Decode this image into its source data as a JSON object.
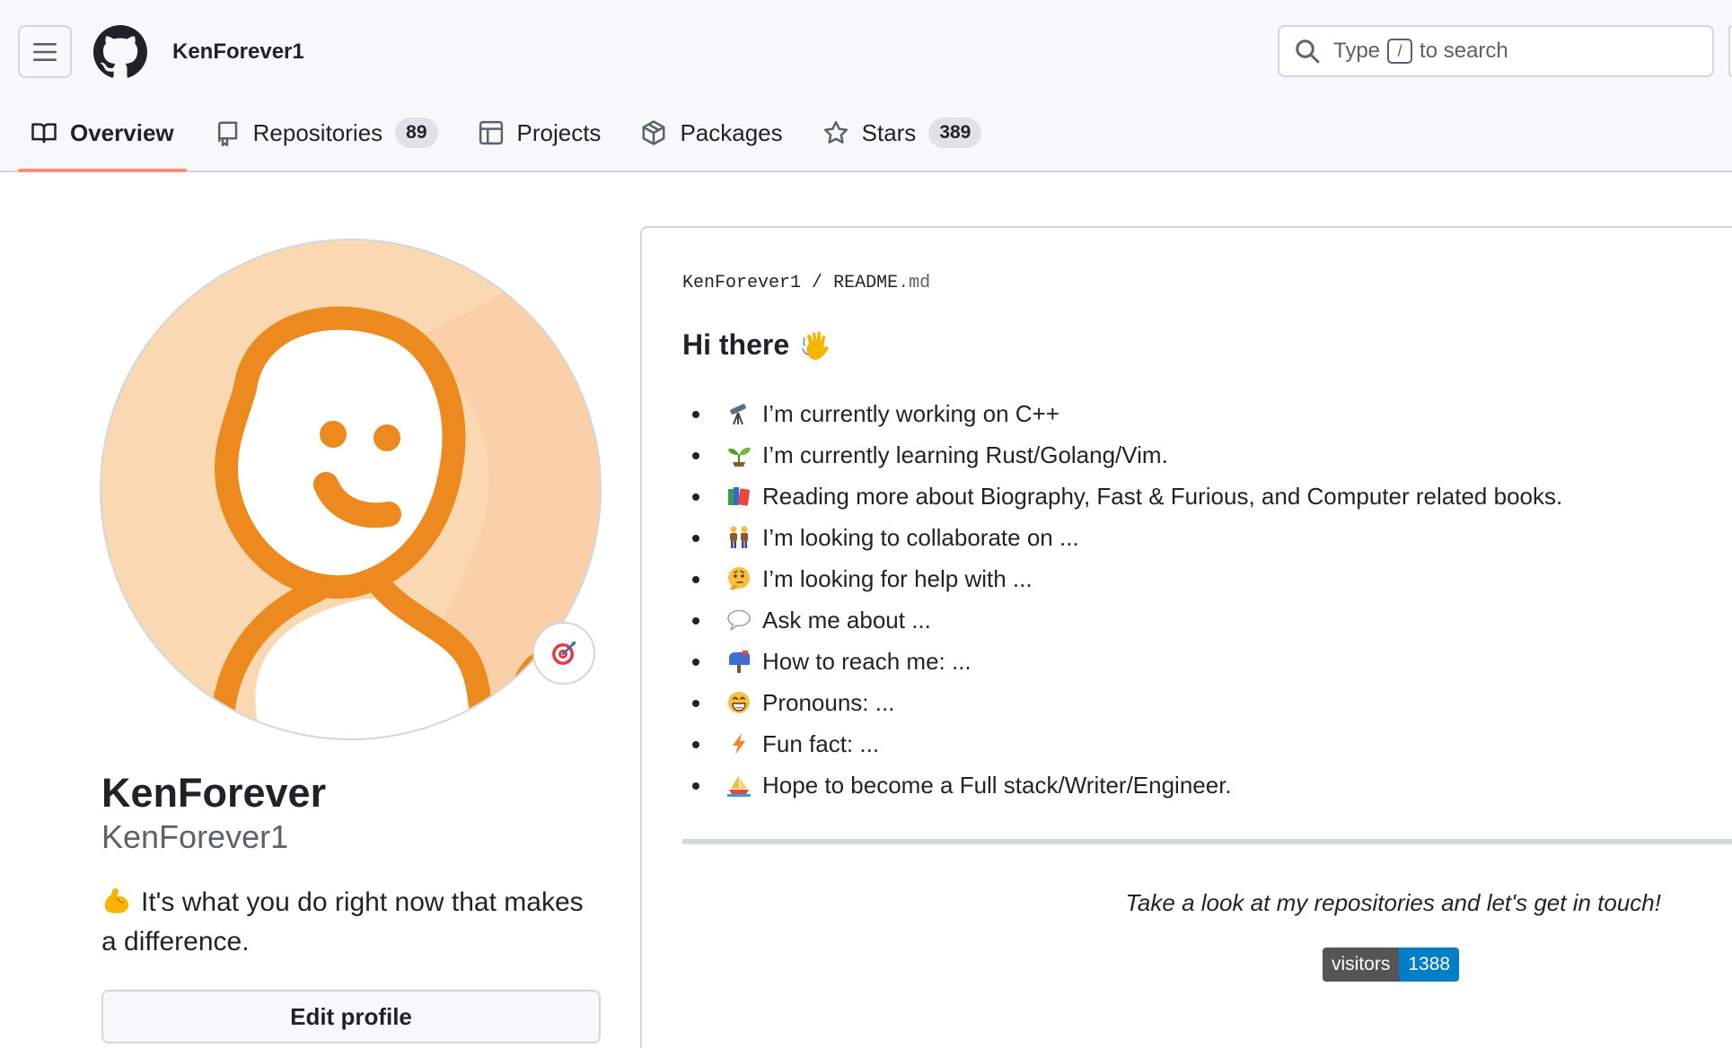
{
  "header": {
    "username": "KenForever1",
    "search": {
      "prefix": "Type",
      "key": "/",
      "suffix": "to search"
    }
  },
  "tabs": [
    {
      "label": "Overview",
      "icon": "book-icon",
      "active": true
    },
    {
      "label": "Repositories",
      "icon": "repo-icon",
      "count": "89"
    },
    {
      "label": "Projects",
      "icon": "table-icon"
    },
    {
      "label": "Packages",
      "icon": "package-icon"
    },
    {
      "label": "Stars",
      "icon": "star-icon",
      "count": "389"
    }
  ],
  "profile": {
    "fullname": "KenForever",
    "login": "KenForever1",
    "bio_emoji": "flexed-biceps",
    "bio": "It's what you do right now that makes a difference.",
    "edit_label": "Edit profile",
    "status_emoji": "dart"
  },
  "readme": {
    "crumb_user": "KenForever1",
    "crumb_sep": "/",
    "crumb_file": "README",
    "crumb_ext": ".md",
    "heading": "Hi there",
    "heading_emoji": "waving-hand",
    "items": [
      {
        "emoji": "telescope",
        "text": "I’m currently working on C++"
      },
      {
        "emoji": "seedling",
        "text": "I’m currently learning Rust/Golang/Vim."
      },
      {
        "emoji": "books",
        "text": "Reading more about Biography, Fast & Furious, and Computer related books."
      },
      {
        "emoji": "people-holding-hands",
        "text": "I’m looking to collaborate on ..."
      },
      {
        "emoji": "thinking-face",
        "text": "I’m looking for help with ..."
      },
      {
        "emoji": "speech-balloon",
        "text": "Ask me about ..."
      },
      {
        "emoji": "mailbox",
        "text": "How to reach me: ..."
      },
      {
        "emoji": "grinning-face",
        "text": "Pronouns: ..."
      },
      {
        "emoji": "lightning",
        "text": "Fun fact: ..."
      },
      {
        "emoji": "sailboat",
        "text": "Hope to become a Full stack/Writer/Engineer."
      }
    ],
    "tagline": "Take a look at my repositories and let's get in touch!",
    "badge_label": "visitors",
    "badge_value": "1388"
  },
  "colors": {
    "accent_underline": "#fd8c73",
    "avatar_orange": "#ec8a1f",
    "avatar_bg": "#f9d8b2",
    "badge_value_bg": "#007ec6",
    "badge_label_bg": "#555555"
  }
}
